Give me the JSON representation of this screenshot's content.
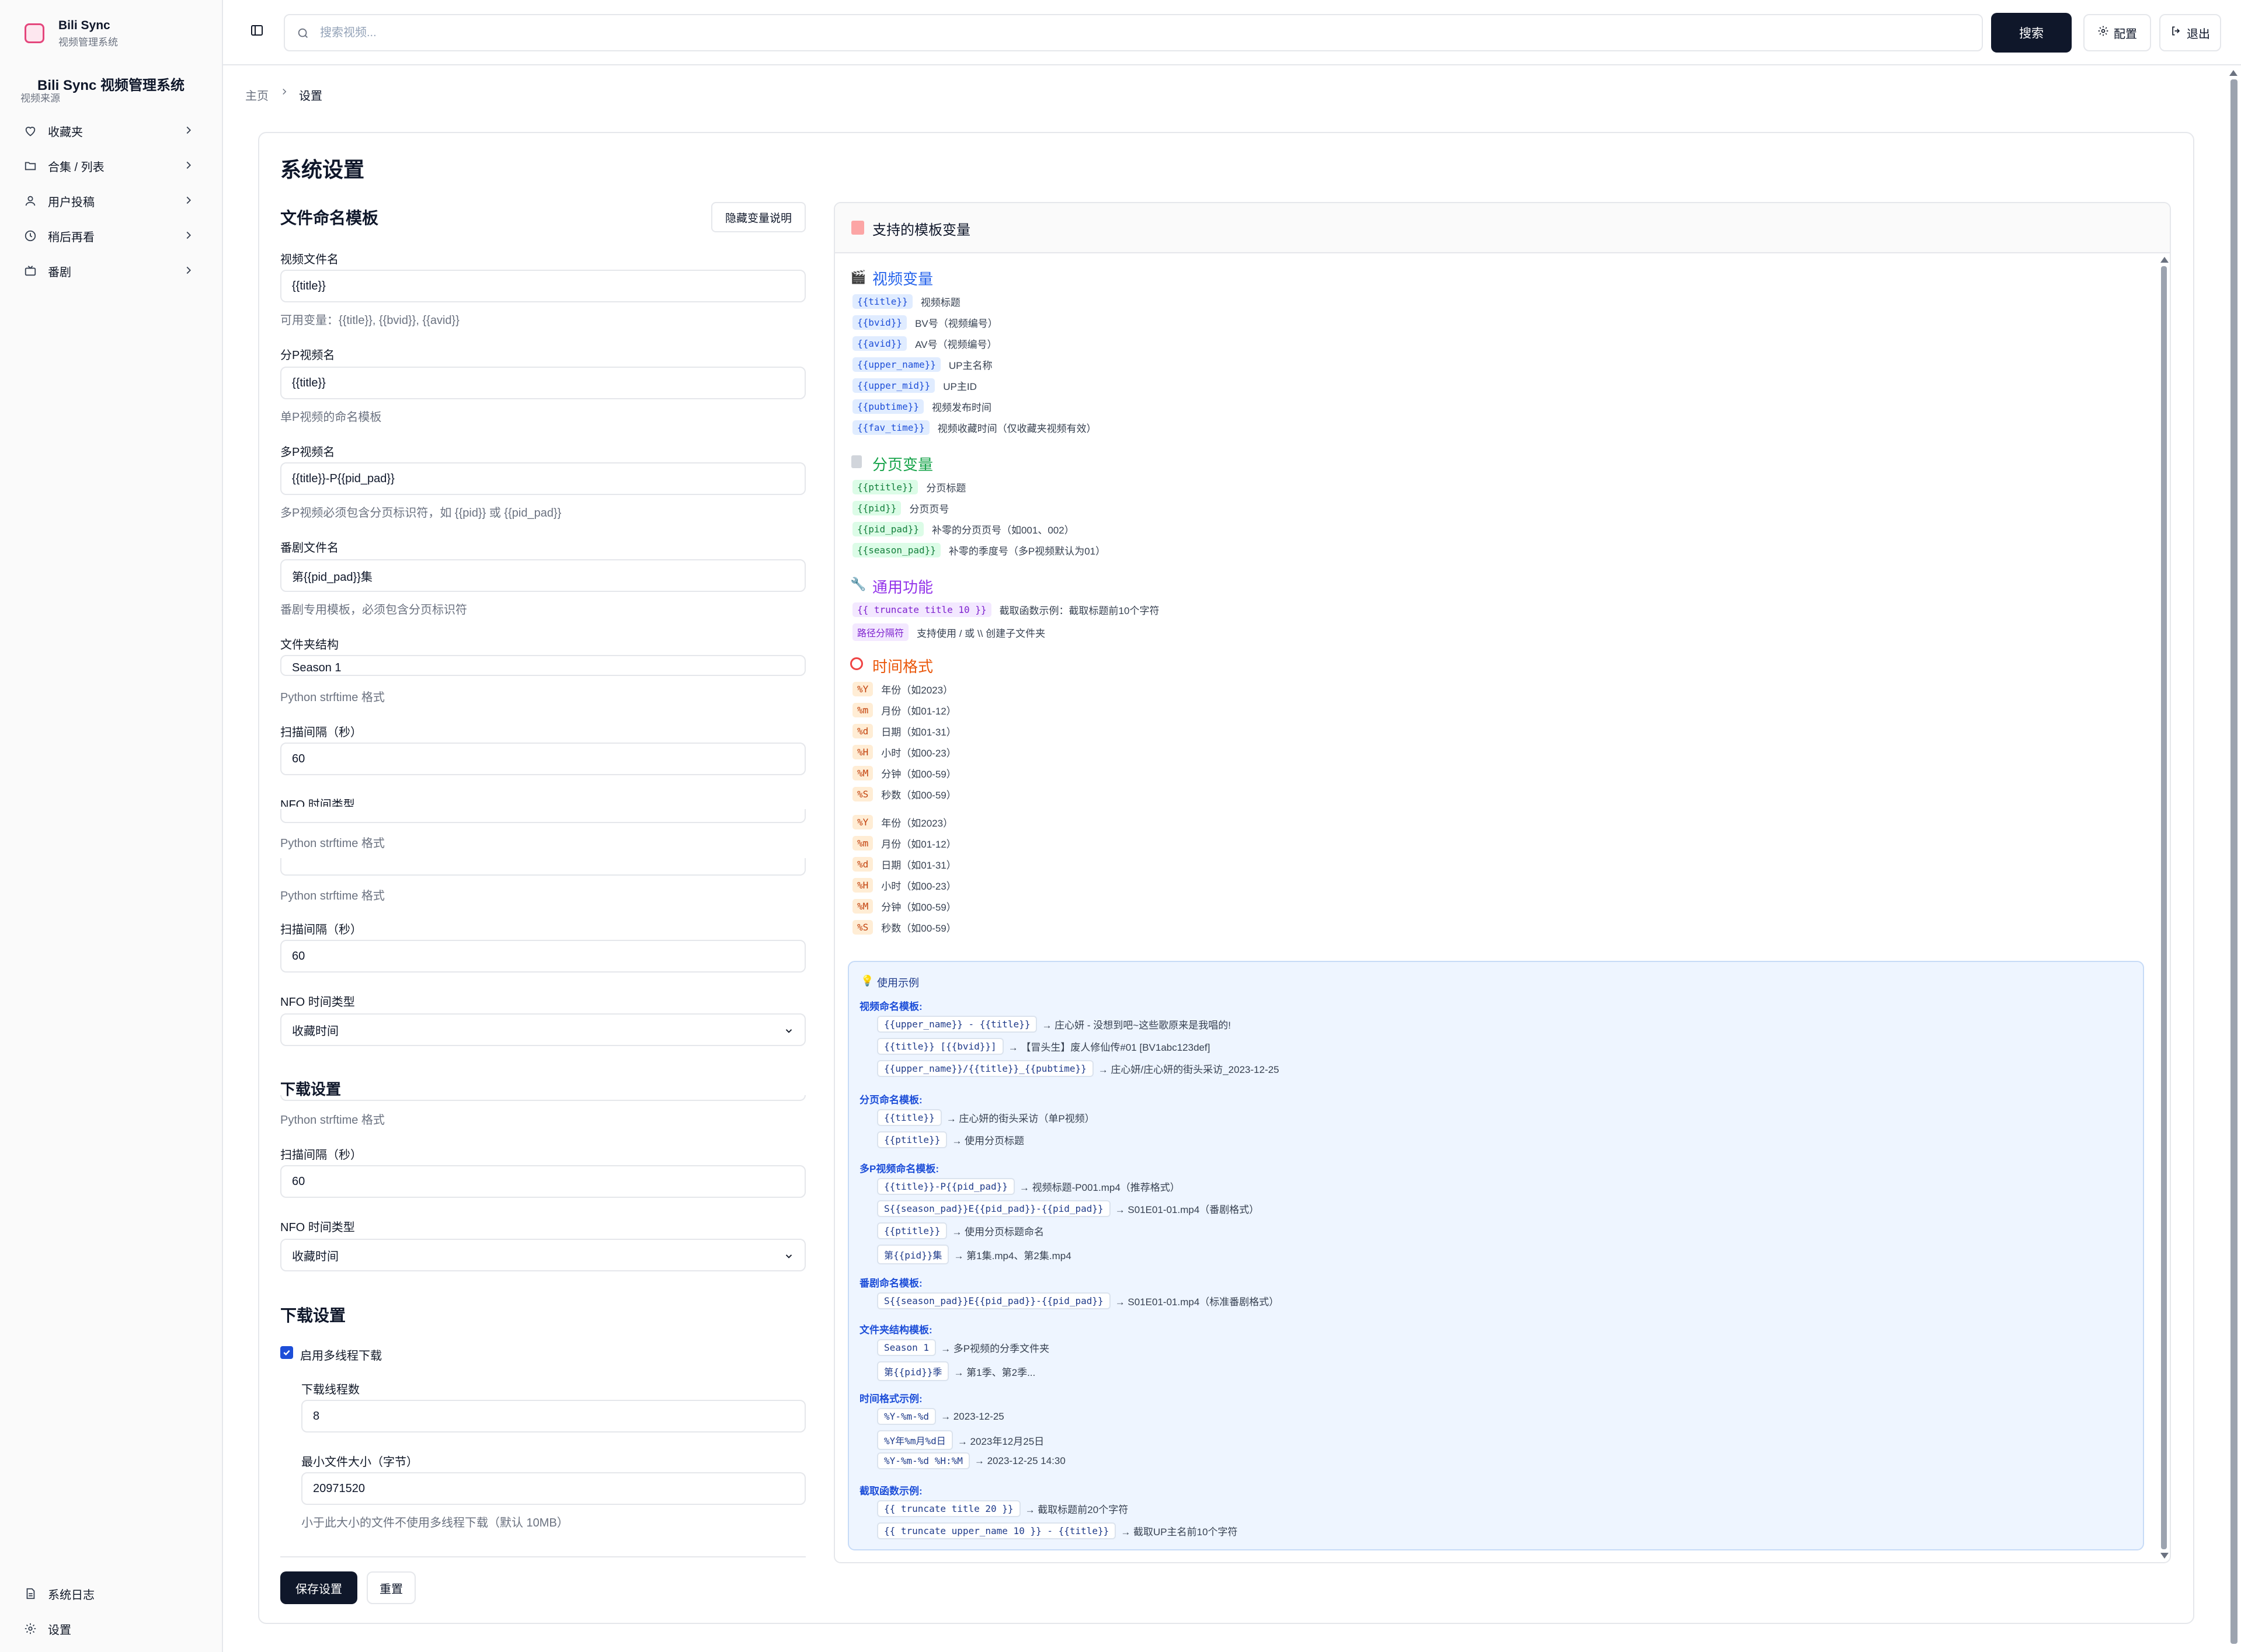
{
  "brand": {
    "name": "Bili Sync",
    "subtitle": "视频管理系统",
    "system_title": "Bili Sync 视频管理系统",
    "source_label": "视频来源"
  },
  "sidebar": {
    "items": [
      {
        "label": "收藏夹",
        "icon": "heart-icon"
      },
      {
        "label": "合集 / 列表",
        "icon": "folder-icon"
      },
      {
        "label": "用户投稿",
        "icon": "user-icon"
      },
      {
        "label": "稍后再看",
        "icon": "clock-icon"
      },
      {
        "label": "番剧",
        "icon": "tv-icon"
      }
    ],
    "footer": [
      {
        "label": "系统日志",
        "icon": "file-icon"
      },
      {
        "label": "设置",
        "icon": "gear-icon"
      }
    ]
  },
  "header": {
    "search_placeholder": "搜索视频...",
    "search_button": "搜索",
    "config_button": "配置",
    "logout_button": "退出"
  },
  "breadcrumb": {
    "home": "主页",
    "current": "设置"
  },
  "settings": {
    "title": "系统设置",
    "naming_title": "文件命名模板",
    "hide_vars_button": "隐藏变量说明",
    "video_name_label": "视频文件名",
    "video_name_value": "{{title}}",
    "video_name_help": "可用变量：{{title}}, {{bvid}}, {{avid}}",
    "page_name_label": "分P视频名",
    "page_name_value": "{{title}}",
    "page_name_help": "单P视频的命名模板",
    "multi_page_label": "多P视频名",
    "multi_page_value": "{{title}}-P{{pid_pad}}",
    "multi_page_help": "多P视频必须包含分页标识符，如 {{pid}} 或 {{pid_pad}}",
    "bangumi_label": "番剧文件名",
    "bangumi_value": "第{{pid_pad}}集",
    "bangumi_help": "番剧专用模板，必须包含分页标识符",
    "folder_label": "文件夹结构",
    "folder_value": "Season 1",
    "strftime_help": "Python strftime 格式",
    "scan_label": "扫描间隔（秒）",
    "scan_value": "60",
    "nfo_label_cut": "NFO 时间类型",
    "nfo_label": "NFO 时间类型",
    "nfo_value": "收藏时间",
    "download_title": "下载设置",
    "multithread_label": "启用多线程下载",
    "threads_label": "下载线程数",
    "threads_value": "8",
    "min_size_label": "最小文件大小（字节）",
    "min_size_value": "20971520",
    "min_size_help": "小于此大小的文件不使用多线程下载（默认 10MB）",
    "save_button": "保存设置",
    "reset_button": "重置"
  },
  "vars_panel": {
    "title": "支持的模板变量",
    "video_title": "视频变量",
    "video_vars": [
      {
        "code": "{{title}}",
        "desc": "视频标题"
      },
      {
        "code": "{{bvid}}",
        "desc": "BV号（视频编号）"
      },
      {
        "code": "{{avid}}",
        "desc": "AV号（视频编号）"
      },
      {
        "code": "{{upper_name}}",
        "desc": "UP主名称"
      },
      {
        "code": "{{upper_mid}}",
        "desc": "UP主ID"
      },
      {
        "code": "{{pubtime}}",
        "desc": "视频发布时间"
      },
      {
        "code": "{{fav_time}}",
        "desc": "视频收藏时间（仅收藏夹视频有效）"
      }
    ],
    "page_title": "分页变量",
    "page_vars": [
      {
        "code": "{{ptitle}}",
        "desc": "分页标题"
      },
      {
        "code": "{{pid}}",
        "desc": "分页页号"
      },
      {
        "code": "{{pid_pad}}",
        "desc": "补零的分页页号（如001、002）"
      },
      {
        "code": "{{season_pad}}",
        "desc": "补零的季度号（多P视频默认为01）"
      }
    ],
    "general_title": "通用功能",
    "general_vars": [
      {
        "code": "{{ truncate title 10 }}",
        "desc": "截取函数示例：截取标题前10个字符"
      },
      {
        "code": "路径分隔符",
        "desc": "支持使用 / 或 \\\\ 创建子文件夹"
      }
    ],
    "time_title": "时间格式",
    "time_vars": [
      {
        "code": "%Y",
        "desc": "年份（如2023）"
      },
      {
        "code": "%m",
        "desc": "月份（如01-12）"
      },
      {
        "code": "%d",
        "desc": "日期（如01-31）"
      },
      {
        "code": "%H",
        "desc": "小时（如00-23）"
      },
      {
        "code": "%M",
        "desc": "分钟（如00-59）"
      },
      {
        "code": "%S",
        "desc": "秒数（如00-59）"
      }
    ],
    "examples_title": "使用示例",
    "examples": [
      {
        "heading": "视频命名模板:",
        "rows": [
          {
            "code": "{{upper_name}} - {{title}}",
            "result": "→ 庄心妍 - 没想到吧~这些歌原来是我唱的!"
          },
          {
            "code": "{{title}} [{{bvid}}]",
            "result": "→ 【冒头生】废人修仙传#01 [BV1abc123def]"
          },
          {
            "code": "{{upper_name}}/{{title}}_{{pubtime}}",
            "result": "→ 庄心妍/庄心妍的街头采访_2023-12-25"
          }
        ]
      },
      {
        "heading": "分页命名模板:",
        "rows": [
          {
            "code": "{{title}}",
            "result": "→ 庄心妍的街头采访（单P视频）"
          },
          {
            "code": "{{ptitle}}",
            "result": "→ 使用分页标题"
          }
        ]
      },
      {
        "heading": "多P视频命名模板:",
        "rows": [
          {
            "code": "{{title}}-P{{pid_pad}}",
            "result": "→ 视频标题-P001.mp4（推荐格式）"
          },
          {
            "code": "S{{season_pad}}E{{pid_pad}}-{{pid_pad}}",
            "result": "→ S01E01-01.mp4（番剧格式）"
          },
          {
            "code": "{{ptitle}}",
            "result": "→ 使用分页标题命名"
          },
          {
            "code": "第{{pid}}集",
            "result": "→ 第1集.mp4、第2集.mp4"
          }
        ]
      },
      {
        "heading": "番剧命名模板:",
        "rows": [
          {
            "code": "S{{season_pad}}E{{pid_pad}}-{{pid_pad}}",
            "result": "→ S01E01-01.mp4（标准番剧格式）"
          }
        ]
      },
      {
        "heading": "文件夹结构模板:",
        "rows": [
          {
            "code": "Season 1",
            "result": "→ 多P视频的分季文件夹"
          },
          {
            "code": "第{{pid}}季",
            "result": "→ 第1季、第2季..."
          }
        ]
      },
      {
        "heading": "时间格式示例:",
        "rows": [
          {
            "code": "%Y-%m-%d",
            "result": "→ 2023-12-25"
          },
          {
            "code": "%Y年%m月%d日",
            "result": "→ 2023年12月25日"
          },
          {
            "code": "%Y-%m-%d %H:%M",
            "result": "→ 2023-12-25 14:30"
          }
        ]
      },
      {
        "heading": "截取函数示例:",
        "rows": [
          {
            "code": "{{ truncate title 20 }}",
            "result": "→ 截取标题前20个字符"
          },
          {
            "code": "{{ truncate upper_name 10 }} - {{title}}",
            "result": "→ 截取UP主名前10个字符"
          }
        ]
      }
    ]
  },
  "colors": {
    "primary": "#0f172a",
    "border": "#e5e7eb",
    "video": "#2563eb",
    "page": "#16a34a",
    "general": "#9333ea",
    "time": "#ea580c",
    "example_bg": "#eef5ff"
  }
}
